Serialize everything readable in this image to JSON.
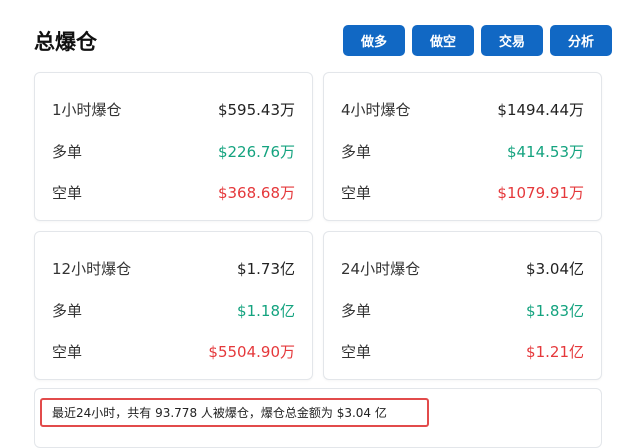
{
  "header": {
    "title": "总爆仓",
    "buttons": [
      "做多",
      "做空",
      "交易",
      "分析"
    ]
  },
  "cards": [
    {
      "total_label": "1小时爆仓",
      "total_value": "$595.43万",
      "long_label": "多单",
      "long_value": "$226.76万",
      "short_label": "空单",
      "short_value": "$368.68万"
    },
    {
      "total_label": "4小时爆仓",
      "total_value": "$1494.44万",
      "long_label": "多单",
      "long_value": "$414.53万",
      "short_label": "空单",
      "short_value": "$1079.91万"
    },
    {
      "total_label": "12小时爆仓",
      "total_value": "$1.73亿",
      "long_label": "多单",
      "long_value": "$1.18亿",
      "short_label": "空单",
      "short_value": "$5504.90万"
    },
    {
      "total_label": "24小时爆仓",
      "total_value": "$3.04亿",
      "long_label": "多单",
      "long_value": "$1.83亿",
      "short_label": "空单",
      "short_value": "$1.21亿"
    }
  ],
  "summary": {
    "text": "最近24小时，共有 93.778 人被爆仓，爆仓总金额为 $3.04 亿"
  },
  "colors": {
    "button_bg": "#1168c4",
    "long": "#14a37f",
    "short": "#e5383b",
    "highlight_border": "#e24b4b"
  }
}
